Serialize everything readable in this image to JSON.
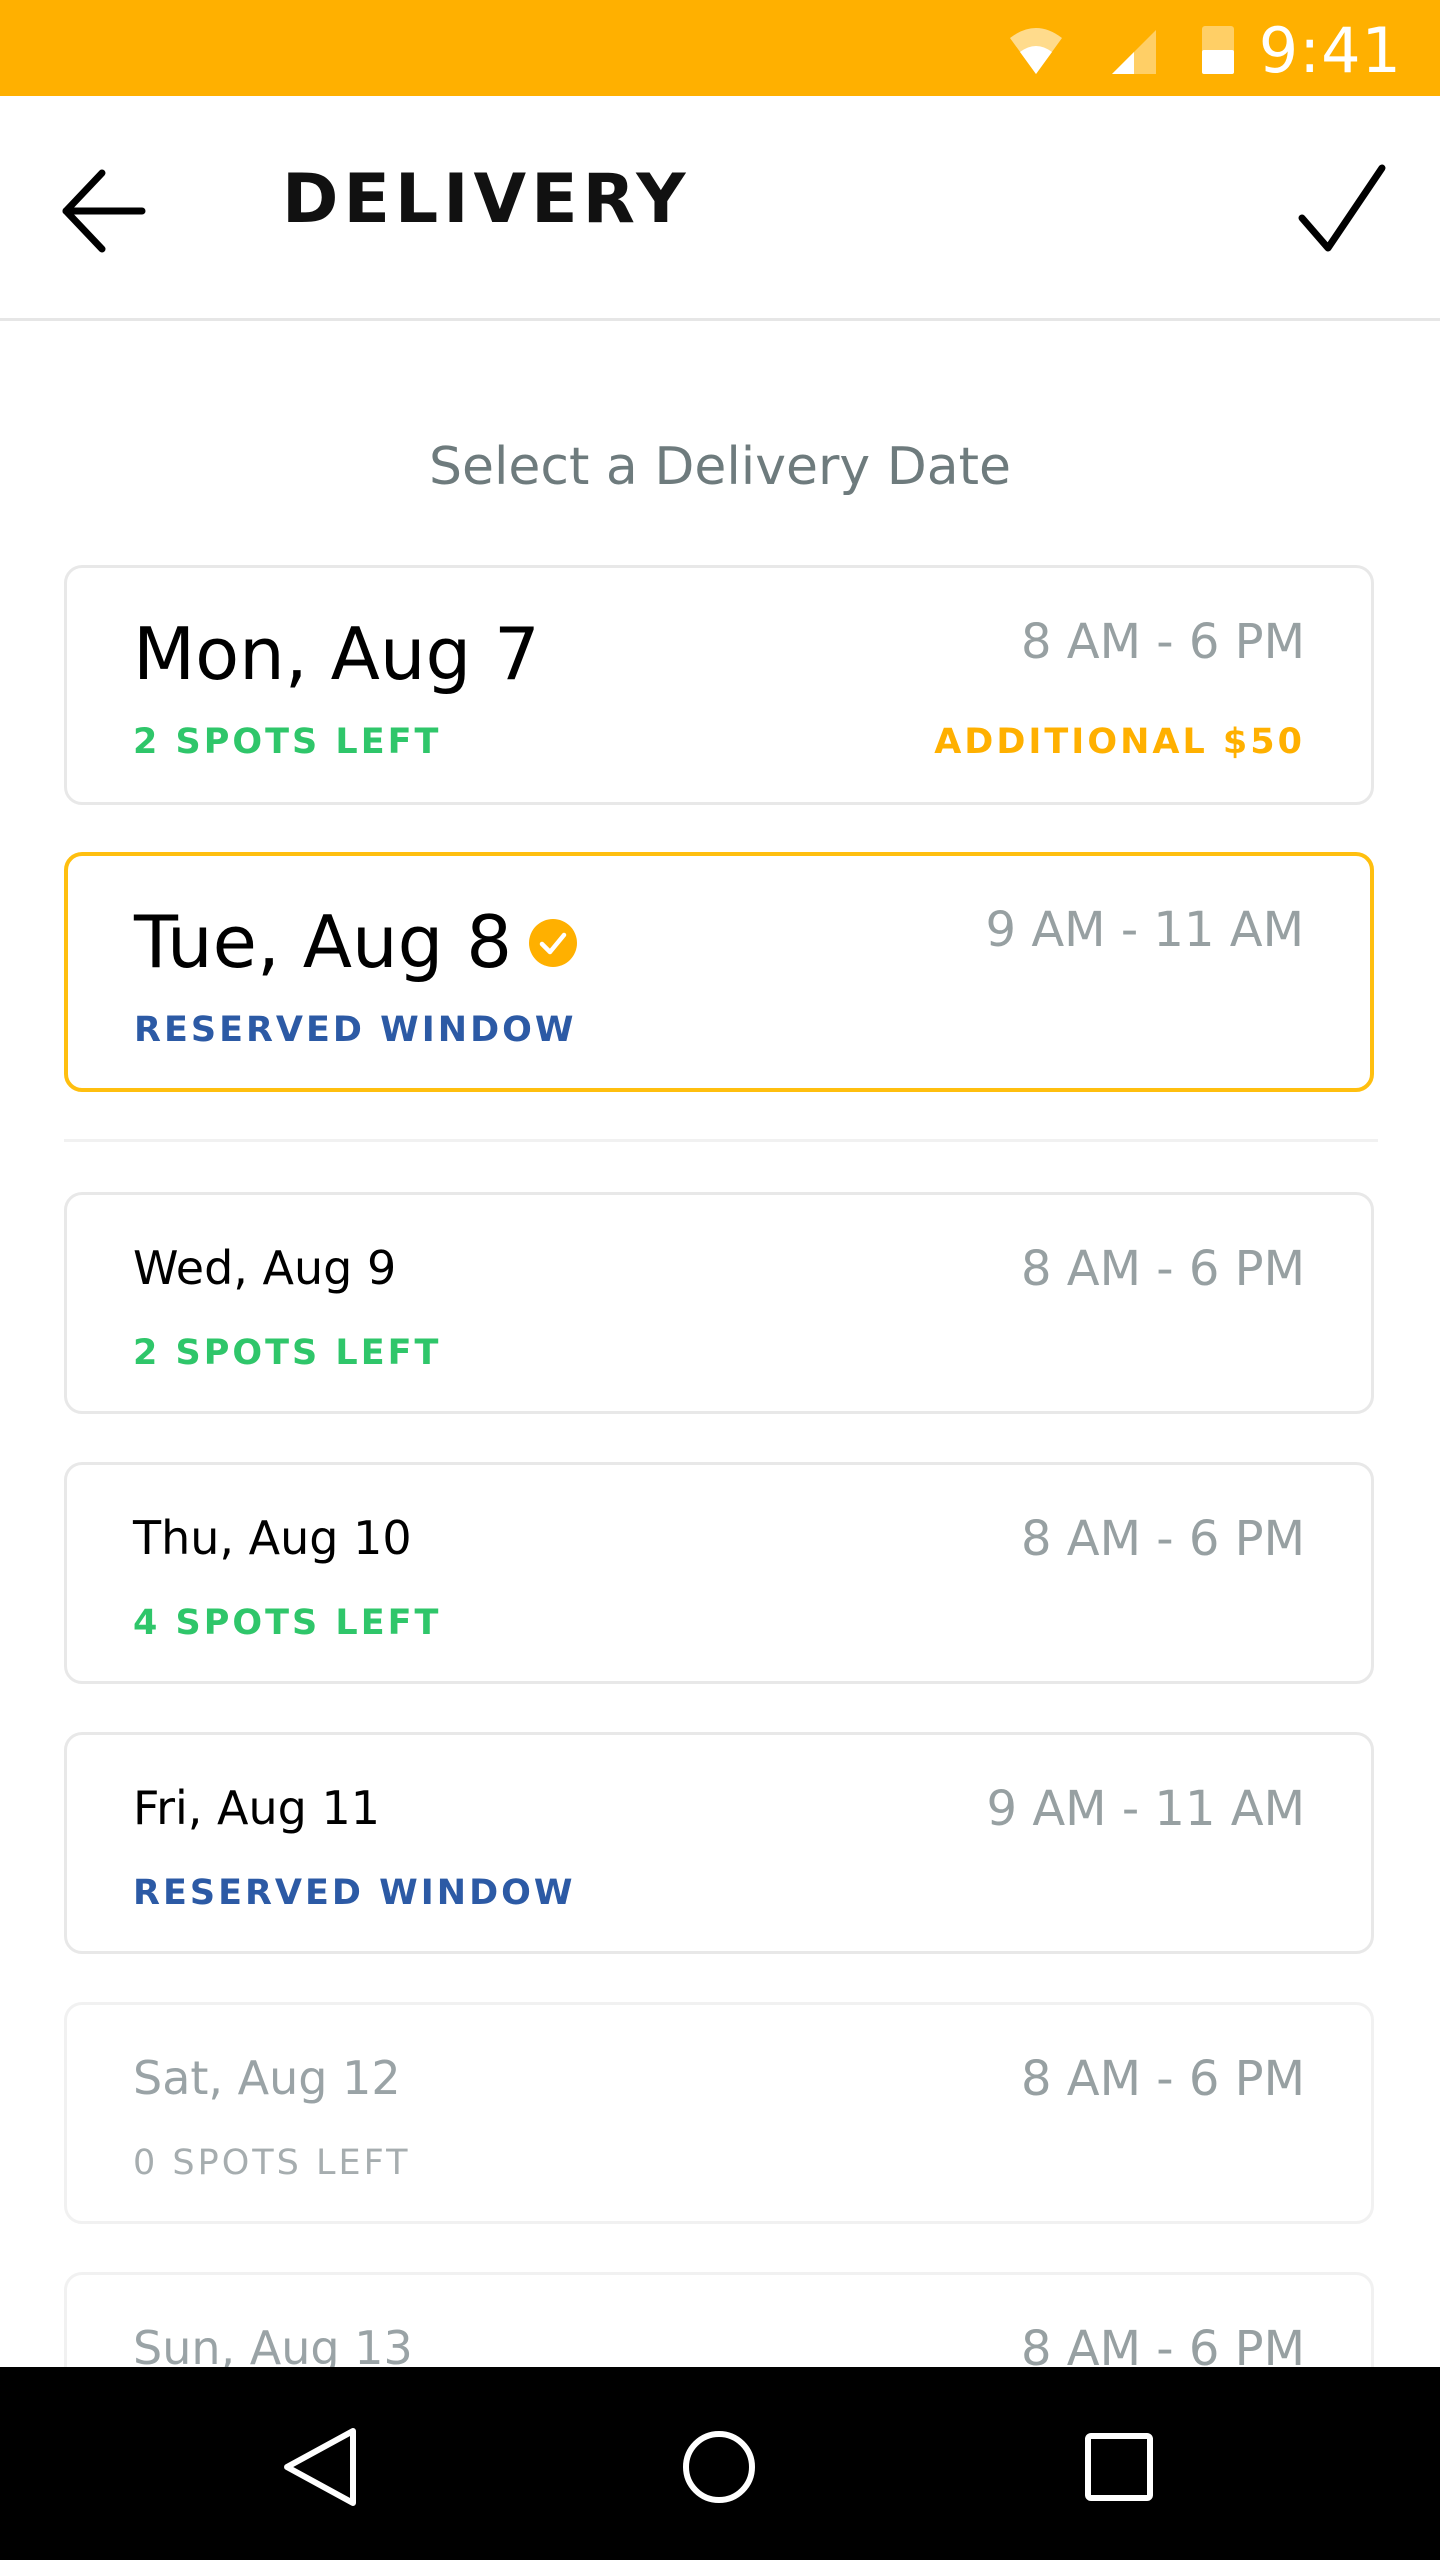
{
  "status_bar": {
    "time": "9:41",
    "background_color": "#FFB000",
    "icons": [
      "wifi-icon",
      "cellular-signal-icon",
      "battery-icon"
    ]
  },
  "app_bar": {
    "title": "DELIVERY",
    "back_icon": "arrow-left-icon",
    "confirm_icon": "checkmark-icon"
  },
  "prompt": "Select a Delivery Date",
  "colors": {
    "accent": "#FFB000",
    "selected_border": "#FFBF0F",
    "spots_green": "#2FC66A",
    "reserved_blue": "#2C5AA5",
    "muted_grey": "#97A0A2"
  },
  "dates": [
    {
      "date": "Mon, Aug 7",
      "time": "8 AM - 6 PM",
      "status": "2 SPOTS LEFT",
      "status_type": "spots",
      "surcharge": "ADDITIONAL $50",
      "selected": false,
      "disabled": false
    },
    {
      "date": "Tue, Aug 8",
      "time": "9 AM - 11 AM",
      "status": "RESERVED WINDOW",
      "status_type": "reserved",
      "selected": true,
      "selected_icon": "check-circle-icon",
      "disabled": false
    },
    {
      "date": "Wed, Aug 9",
      "time": "8 AM - 6 PM",
      "status": "2 SPOTS LEFT",
      "status_type": "spots",
      "selected": false,
      "disabled": false
    },
    {
      "date": "Thu, Aug 10",
      "time": "8 AM - 6 PM",
      "status": "4 SPOTS LEFT",
      "status_type": "spots",
      "selected": false,
      "disabled": false
    },
    {
      "date": "Fri, Aug 11",
      "time": "9 AM - 11 AM",
      "status": "RESERVED WINDOW",
      "status_type": "reserved",
      "selected": false,
      "disabled": false
    },
    {
      "date": "Sat, Aug 12",
      "time": "8 AM - 6 PM",
      "status": "0 SPOTS LEFT",
      "status_type": "none",
      "selected": false,
      "disabled": true
    },
    {
      "date": "Sun, Aug 13",
      "time": "8 AM - 6 PM",
      "selected": false,
      "disabled": true
    }
  ],
  "nav_bar": {
    "buttons": [
      "back-triangle-icon",
      "home-circle-icon",
      "recents-square-icon"
    ]
  }
}
